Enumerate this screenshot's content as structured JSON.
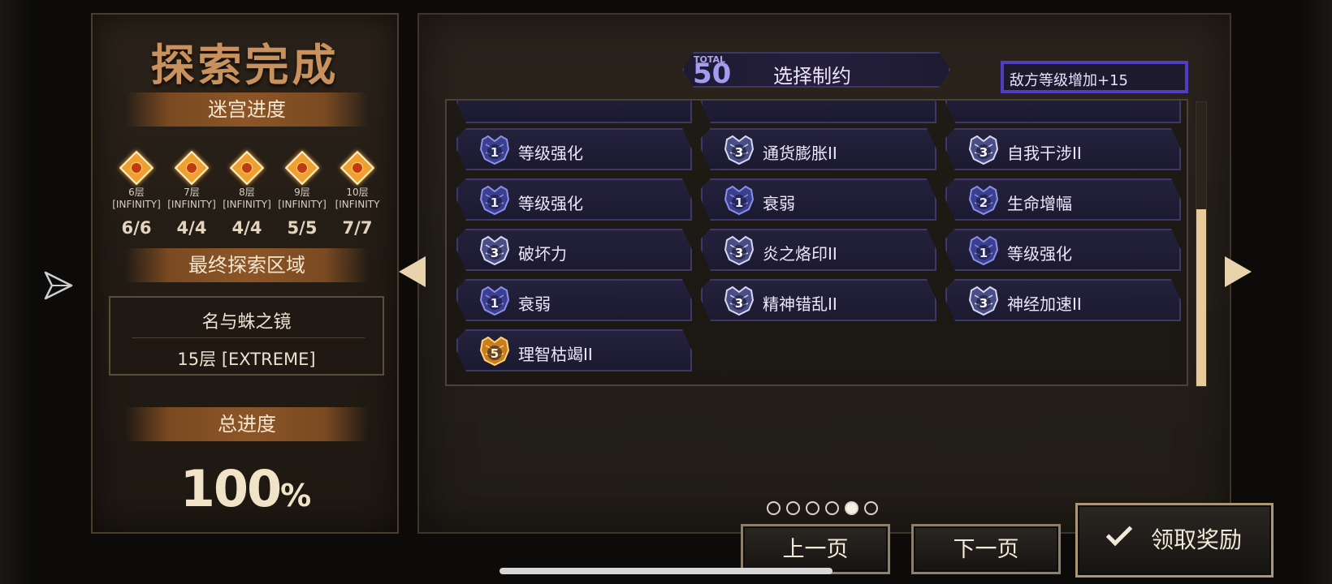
{
  "left": {
    "title": "探索完成",
    "progress_banner": "迷宫进度",
    "floors": [
      {
        "name": "6层",
        "mode": "[INFINITY]",
        "count": "6/6"
      },
      {
        "name": "7层",
        "mode": "[INFINITY]",
        "count": "4/4"
      },
      {
        "name": "8层",
        "mode": "[INFINITY]",
        "count": "4/4"
      },
      {
        "name": "9层",
        "mode": "[INFINITY]",
        "count": "5/5"
      },
      {
        "name": "10层",
        "mode": "[INFINITY",
        "count": "7/7"
      }
    ],
    "final_area_banner": "最终探索区域",
    "final_area_name": "名与蛛之镜",
    "final_area_floor": "15层 [EXTREME]",
    "total_banner": "总进度",
    "total_value": "100",
    "total_unit": "%"
  },
  "right": {
    "total_tag": "TOTAL",
    "total_value": "50",
    "section_title": "选择制约",
    "effect_text": "敌方等级增加+15",
    "constraints": [
      {
        "level": "1",
        "label": "等级强化",
        "color": "blue"
      },
      {
        "level": "3",
        "label": "通货膨胀II",
        "color": "silver"
      },
      {
        "level": "3",
        "label": "自我干涉II",
        "color": "silver"
      },
      {
        "level": "1",
        "label": "等级强化",
        "color": "blue"
      },
      {
        "level": "1",
        "label": "衰弱",
        "color": "blue"
      },
      {
        "level": "2",
        "label": "生命增幅",
        "color": "blue"
      },
      {
        "level": "3",
        "label": "破坏力",
        "color": "silver"
      },
      {
        "level": "3",
        "label": "炎之烙印II",
        "color": "silver"
      },
      {
        "level": "1",
        "label": "等级强化",
        "color": "blue"
      },
      {
        "level": "1",
        "label": "衰弱",
        "color": "blue"
      },
      {
        "level": "3",
        "label": "精神错乱II",
        "color": "silver"
      },
      {
        "level": "3",
        "label": "神经加速II",
        "color": "silver"
      },
      {
        "level": "5",
        "label": "理智枯竭II",
        "color": "gold"
      }
    ],
    "page_count": 6,
    "current_page": 5
  },
  "buttons": {
    "prev": "上一页",
    "next": "下一页",
    "claim": "领取奖励"
  },
  "icons": {
    "send": "send-icon",
    "check": "check-icon",
    "arrow_left": "arrow-left-icon",
    "arrow_right": "arrow-right-icon",
    "floor_marker": "diamond-marker-icon"
  },
  "colors": {
    "accent_gold": "#c9915d",
    "effect_border": "#4f3fc0",
    "scroll_thumb": "#e7c99a"
  }
}
